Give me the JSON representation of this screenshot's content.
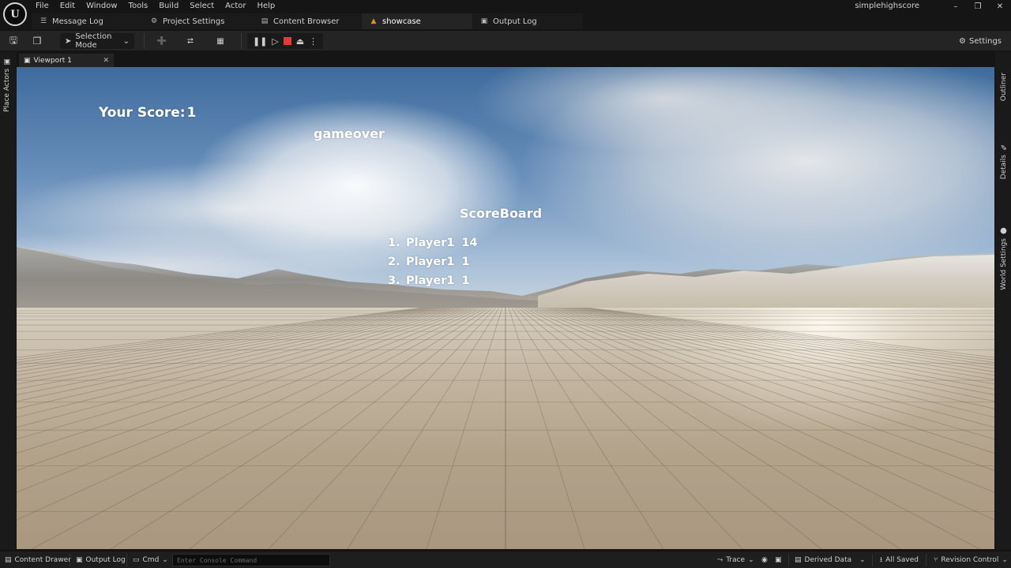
{
  "menu": [
    "File",
    "Edit",
    "Window",
    "Tools",
    "Build",
    "Select",
    "Actor",
    "Help"
  ],
  "logo_text": "U",
  "project_name": "simplehighscore",
  "window_controls": [
    "–",
    "❐",
    "✕"
  ],
  "doc_tabs": [
    {
      "label": "Message Log",
      "icon": "☰"
    },
    {
      "label": "Project Settings",
      "icon": "⚙"
    },
    {
      "label": "Content Browser",
      "icon": "▤"
    },
    {
      "label": "showcase",
      "icon": "▲"
    },
    {
      "label": "Output Log",
      "icon": "▣"
    }
  ],
  "toolbar": {
    "selection_mode": "Selection Mode",
    "settings": "Settings"
  },
  "left_panel": {
    "place_actors": "Place Actors"
  },
  "right_panel": {
    "outliner": "Outliner",
    "details": "Details",
    "world_settings": "World Settings"
  },
  "viewport": {
    "tab_label": "Viewport 1",
    "close": "✕"
  },
  "hud": {
    "your_score_label": "Your Score:",
    "your_score_value": "1",
    "gameover": "gameover",
    "scoreboard_title": "ScoreBoard",
    "scoreboard": [
      {
        "rank": "1.",
        "name": "Player1",
        "score": "14"
      },
      {
        "rank": "2.",
        "name": "Player1",
        "score": "1"
      },
      {
        "rank": "3.",
        "name": "Player1",
        "score": "1"
      }
    ]
  },
  "status": {
    "content_drawer": "Content Drawer",
    "output_log": "Output Log",
    "cmd": "Cmd",
    "console_placeholder": "Enter Console Command",
    "trace": "Trace",
    "derived_data": "Derived Data",
    "all_saved": "All Saved",
    "revision_control": "Revision Control"
  },
  "colors": {
    "accent_warning": "#e08b28",
    "stop_red": "#e23b3b",
    "panel": "#242424",
    "background": "#151515"
  }
}
